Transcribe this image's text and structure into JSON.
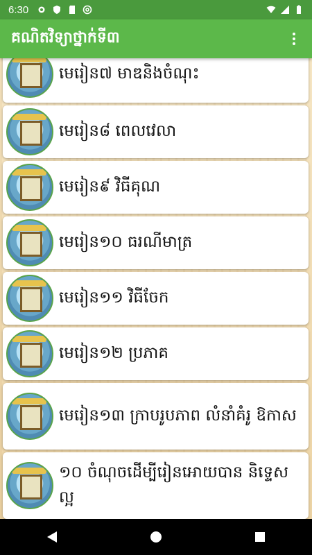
{
  "status_bar": {
    "time": "6:30",
    "icons": [
      "gear-icon",
      "shield-icon",
      "sd-card-icon",
      "at-sign-icon"
    ],
    "right_icons": [
      "wifi-icon",
      "signal-icon",
      "battery-icon"
    ]
  },
  "app_bar": {
    "title": "គណិតវិទ្យាថ្នាក់ទី៣",
    "menu_icon": "more-vert-icon"
  },
  "lessons": [
    {
      "label": "មេរៀន៧ មាឌនិងចំណុះ"
    },
    {
      "label": "មេរៀន៨ ពេលវេលា"
    },
    {
      "label": "មេរៀន៩ វិធីគុណ"
    },
    {
      "label": "មេរៀន១០ ធរណីមាត្រ"
    },
    {
      "label": "មេរៀន១១ វិធីចែក"
    },
    {
      "label": "មេរៀន១២ ប្រភាគ"
    },
    {
      "label": "មេរៀន១៣ ក្រាបរូបភាព លំនាំគំរូ ឱកាស"
    },
    {
      "label": "១០ ចំណុចដើម្បីរៀនអោយបាន និទ្ទេសល្អ"
    }
  ],
  "nav_bar": {
    "buttons": [
      "back-icon",
      "home-icon",
      "recents-icon"
    ]
  },
  "colors": {
    "status_bar": "#4a9a3d",
    "app_bar": "#5cb84a",
    "card": "#ffffff",
    "background": "#f3e3c0"
  }
}
